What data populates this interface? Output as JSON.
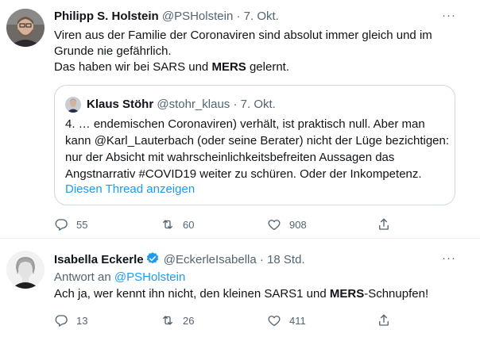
{
  "tweets": [
    {
      "name": "Philipp S. Holstein",
      "handle": "@PSHolstein",
      "separator": "·",
      "time": "7. Okt.",
      "text_parts": [
        "Viren aus der Familie der Coronaviren sind absolut immer gleich und im",
        "Grunde nie gefährlich.",
        "Das haben wir bei SARS und ",
        "MERS",
        " gelernt."
      ],
      "quote": {
        "name": "Klaus Stöhr",
        "handle": "@stohr_klaus",
        "separator": "·",
        "time": "7. Okt.",
        "lines": [
          "4. … endemischen Coronaviren) verhält, ist praktisch null. Aber man",
          "kann @Karl_Lauterbach (oder seine Berater) nicht der Lüge bezichtigen:",
          "nur der Absicht mit wahrscheinlichkeitsbefreiten Aussagen das",
          "Angstnarrativ #COVID19 weiter zu schüren. Oder der Inkompetenz."
        ],
        "thread_link": "Diesen Thread anzeigen"
      },
      "stats": {
        "replies": "55",
        "retweets": "60",
        "likes": "908"
      }
    },
    {
      "name": "Isabella Eckerle",
      "handle": "@EckerleIsabella",
      "separator": "·",
      "time": "18 Std.",
      "reply_to_label": "Antwort an",
      "reply_to_handle": "@PSHolstein",
      "text_parts": [
        "Ach ja, wer kennt ihn nicht, den kleinen SARS1 und ",
        "MERS",
        "-Schnupfen!"
      ],
      "stats": {
        "replies": "13",
        "retweets": "26",
        "likes": "411"
      }
    }
  ],
  "icons": {
    "more": "more-dots-icon",
    "reply": "reply-icon",
    "retweet": "retweet-icon",
    "like": "heart-icon",
    "share": "share-icon",
    "verified": "verified-badge-icon"
  },
  "colors": {
    "text": "#0f1419",
    "secondary": "#536471",
    "link": "#1d9bf0",
    "border": "#cfd9de"
  }
}
